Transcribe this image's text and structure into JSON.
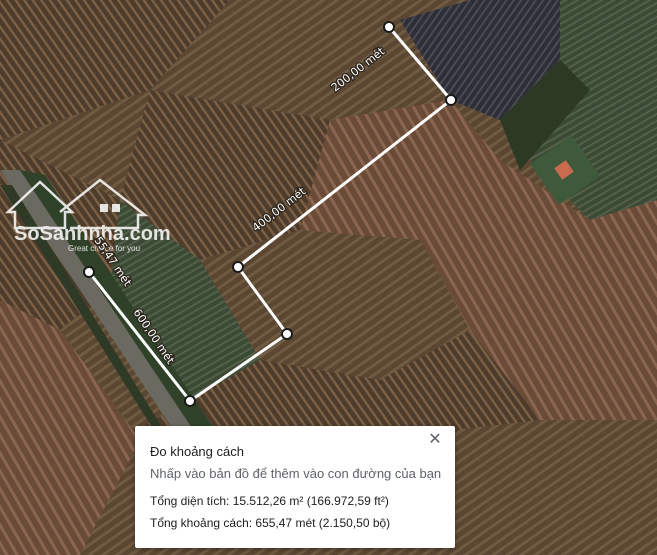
{
  "measure_panel": {
    "title": "Đo khoảng cách",
    "hint": "Nhấp vào bản đồ để thêm vào con đường của bạn",
    "area": "Tổng diện tích: 15.512,26 m² (166.972,59 ft²)",
    "distance": "Tổng khoảng cách: 655,47 mét (2.150,50 bộ)",
    "close_icon": "close-icon"
  },
  "path_labels": {
    "seg1": "200,00 mét",
    "seg2": "400,00 mét",
    "seg3": "600,00 mét",
    "seg4": "55,47 mét"
  },
  "watermark": {
    "brand": "SoSanhnha.com",
    "tagline": "Great choice for you"
  },
  "colors": {
    "path_line": "#ffffff",
    "vertex_fill": "#ffffff",
    "vertex_stroke": "#1a1a1a"
  }
}
